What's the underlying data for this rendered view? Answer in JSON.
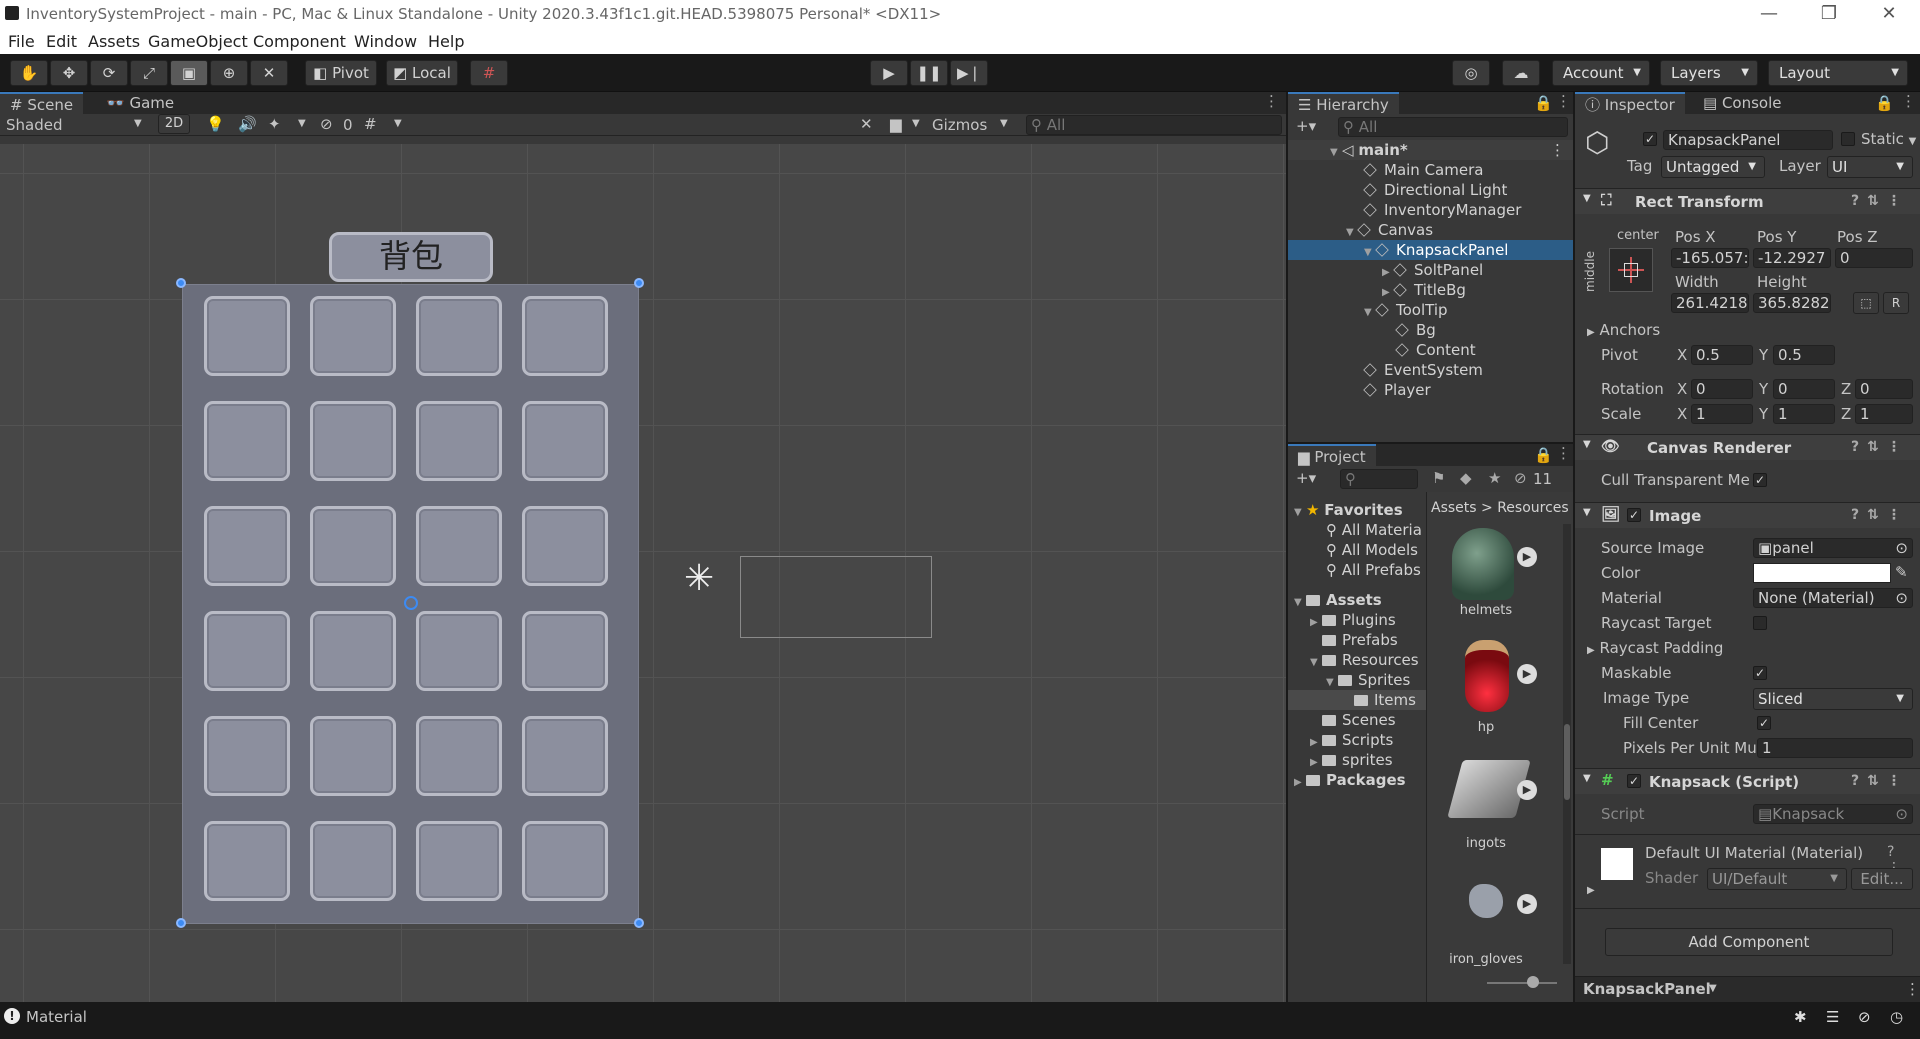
{
  "window": {
    "title": "InventorySystemProject - main - PC, Mac & Linux Standalone - Unity 2020.3.43f1c1.git.HEAD.5398075 Personal* <DX11>",
    "min": "—",
    "max": "❐",
    "close": "✕"
  },
  "menu": [
    "File",
    "Edit",
    "Assets",
    "GameObject",
    "Component",
    "Window",
    "Help"
  ],
  "toolbar": {
    "pivot_label": "Pivot",
    "local_label": "Local",
    "account_label": "Account",
    "layers_label": "Layers",
    "layout_label": "Layout"
  },
  "scene": {
    "tab_scene": "Scene",
    "tab_game": "Game",
    "shading": "Shaded",
    "mode_2d": "2D",
    "hidden_count": "0",
    "gizmos": "Gizmos",
    "search_placeholder": "All",
    "panel_title": "背包"
  },
  "hierarchy": {
    "tab": "Hierarchy",
    "search_placeholder": "All",
    "scene_name": "main*",
    "items": [
      {
        "label": "Main Camera"
      },
      {
        "label": "Directional Light"
      },
      {
        "label": "InventoryManager"
      },
      {
        "label": "Canvas"
      },
      {
        "label": "KnapsackPanel"
      },
      {
        "label": "SoltPanel"
      },
      {
        "label": "TitleBg"
      },
      {
        "label": "ToolTip"
      },
      {
        "label": "Bg"
      },
      {
        "label": "Content"
      },
      {
        "label": "EventSystem"
      },
      {
        "label": "Player"
      }
    ]
  },
  "project": {
    "tab": "Project",
    "hidden_count": "11",
    "breadcrumb_assets": "Assets",
    "breadcrumb_resources": "Resources",
    "favorites": "Favorites",
    "fav_items": [
      "All Materia",
      "All Models",
      "All Prefabs"
    ],
    "assets_root": "Assets",
    "tree": [
      "Plugins",
      "Prefabs",
      "Resources",
      "Sprites",
      "Items",
      "Scenes",
      "Scripts",
      "sprites",
      "Packages"
    ],
    "files": [
      "helmets",
      "hp",
      "ingots",
      "iron_gloves"
    ]
  },
  "inspector": {
    "tab": "Inspector",
    "tab_console": "Console",
    "object_name": "KnapsackPanel",
    "static_label": "Static",
    "tag_label": "Tag",
    "tag_value": "Untagged",
    "layer_label": "Layer",
    "layer_value": "UI",
    "rect_transform": "Rect Transform",
    "anchor_h": "center",
    "anchor_v": "middle",
    "pos_x_label": "Pos X",
    "pos_y_label": "Pos Y",
    "pos_z_label": "Pos Z",
    "pos_x": "-165.057:",
    "pos_y": "-12.2927",
    "pos_z": "0",
    "width_label": "Width",
    "height_label": "Height",
    "width": "261.4218",
    "height": "365.8282",
    "anchors": "Anchors",
    "pivot": "Pivot",
    "pivot_x": "0.5",
    "pivot_y": "0.5",
    "rotation": "Rotation",
    "rot_x": "0",
    "rot_y": "0",
    "rot_z": "0",
    "scale": "Scale",
    "scale_x": "1",
    "scale_y": "1",
    "scale_z": "1",
    "x": "X",
    "y": "Y",
    "z": "Z",
    "r": "R",
    "canvas_renderer": "Canvas Renderer",
    "cull_label": "Cull Transparent Me",
    "image": "Image",
    "source_image_label": "Source Image",
    "source_image": "panel",
    "color_label": "Color",
    "material_label": "Material",
    "material": "None (Material)",
    "raycast_target": "Raycast Target",
    "raycast_padding": "Raycast Padding",
    "maskable": "Maskable",
    "image_type_label": "Image Type",
    "image_type": "Sliced",
    "fill_center": "Fill Center",
    "pixels_per_unit_label": "Pixels Per Unit Mu",
    "pixels_per_unit": "1",
    "knapsack_script": "Knapsack (Script)",
    "script_label": "Script",
    "script": "Knapsack",
    "default_material": "Default UI Material (Material)",
    "shader_label": "Shader",
    "shader": "UI/Default",
    "edit_label": "Edit...",
    "add_component": "Add Component",
    "footer_name": "KnapsackPanel"
  },
  "status": {
    "message": "Material"
  }
}
